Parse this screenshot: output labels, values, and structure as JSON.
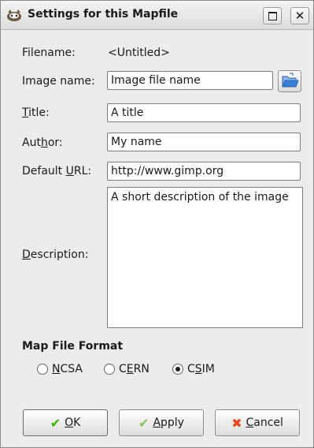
{
  "window": {
    "title": "Settings for this Mapfile"
  },
  "fields": {
    "filename_label": "Filename:",
    "filename_value": "<Untitled>",
    "image_name_label": "Image name:",
    "image_name_value": "Image file name",
    "title_label_u": "T",
    "title_label_rest": "itle:",
    "title_value": "A title",
    "author_label_pre": "Aut",
    "author_label_u": "h",
    "author_label_rest": "or:",
    "author_value": "My name",
    "url_label_pre": "Default ",
    "url_label_u": "U",
    "url_label_rest": "RL:",
    "url_value": "http://www.gimp.org",
    "description_label_u": "D",
    "description_label_rest": "escription:",
    "description_value": "A short description of the image"
  },
  "format": {
    "heading": "Map File Format",
    "options": [
      {
        "pre": "",
        "u": "N",
        "rest": "CSA",
        "selected": false
      },
      {
        "pre": "C",
        "u": "E",
        "rest": "RN",
        "selected": false
      },
      {
        "pre": "C",
        "u": "S",
        "rest": "IM",
        "selected": true
      }
    ]
  },
  "buttons": {
    "ok_u": "O",
    "ok_rest": "K",
    "apply_u": "A",
    "apply_rest": "pply",
    "cancel_u": "C",
    "cancel_rest": "ancel"
  },
  "colors": {
    "ok_check": "#39b700",
    "apply_check": "#8fc060",
    "cancel_x": "#e8491d",
    "folder": "#3a7fd6"
  }
}
